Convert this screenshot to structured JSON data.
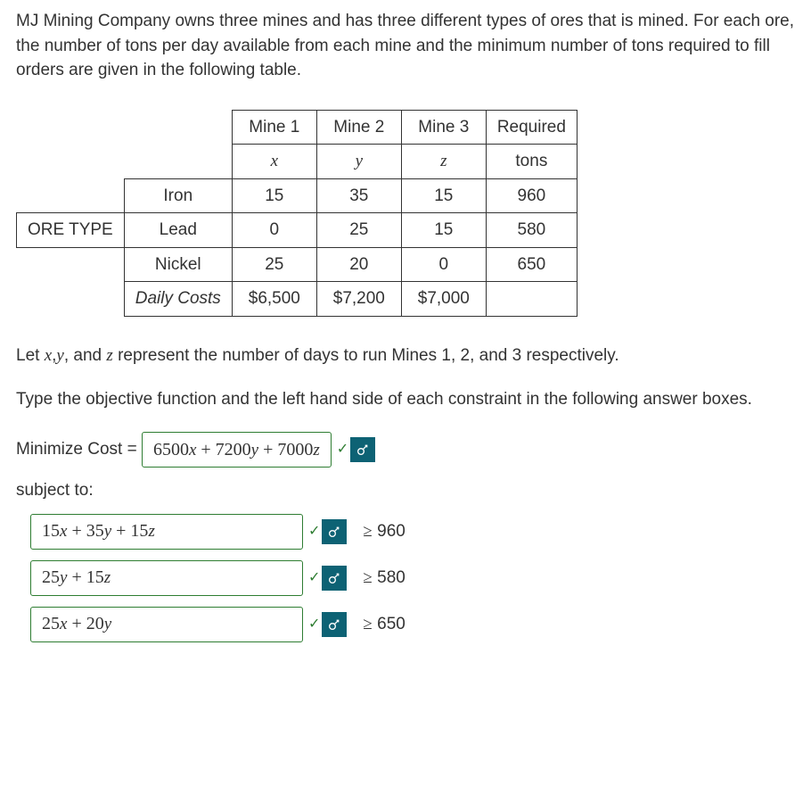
{
  "intro": "MJ Mining Company owns three mines and has three different types of ores that is mined. For each ore, the number of tons per day available from each mine and the minimum number of tons required to fill orders are given in the following table.",
  "table": {
    "headers": {
      "c1": "Mine 1",
      "c2": "Mine 2",
      "c3": "Mine 3",
      "c4": "Required"
    },
    "subheaders": {
      "c1": "x",
      "c2": "y",
      "c3": "z",
      "c4": "tons"
    },
    "rowlabel": "ORE TYPE",
    "rows": [
      {
        "name": "Iron",
        "v1": "15",
        "v2": "35",
        "v3": "15",
        "v4": "960"
      },
      {
        "name": "Lead",
        "v1": "0",
        "v2": "25",
        "v3": "15",
        "v4": "580"
      },
      {
        "name": "Nickel",
        "v1": "25",
        "v2": "20",
        "v3": "0",
        "v4": "650"
      }
    ],
    "costrow": {
      "name": "Daily Costs",
      "v1": "$6,500",
      "v2": "$7,200",
      "v3": "$7,000"
    }
  },
  "let_text_prefix": "Let ",
  "let_text_mid": " represent the number of days to run Mines 1, 2, and 3 respectively.",
  "vars": {
    "x": "x",
    "y": "y",
    "z": "z",
    "sep1": ",",
    "and": ", and "
  },
  "instruction": "Type the objective function and the left hand side of each constraint in the following answer boxes.",
  "objective": {
    "label": "Minimize Cost =",
    "value": "6500x + 7200y + 7000z"
  },
  "subject_to": "subject to:",
  "constraints": [
    {
      "lhs": "15x + 35y + 15z",
      "rhs": "960"
    },
    {
      "lhs": "25y + 15z",
      "rhs": "580"
    },
    {
      "lhs": "25x + 20y",
      "rhs": "650"
    }
  ],
  "ge": "≥"
}
